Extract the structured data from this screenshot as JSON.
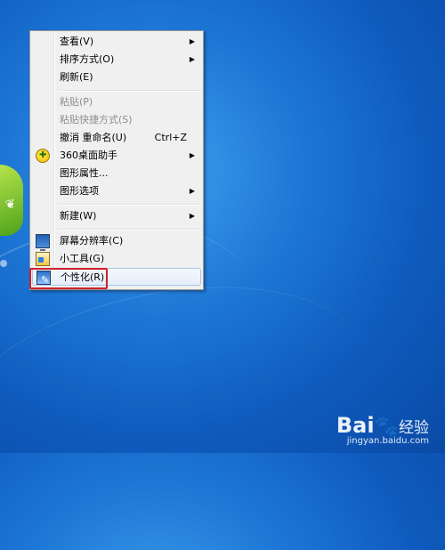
{
  "desktop": {
    "background_color": "#1a6fd0"
  },
  "context_menu": {
    "items": [
      {
        "label": "查看(V)",
        "submenu": true
      },
      {
        "label": "排序方式(O)",
        "submenu": true
      },
      {
        "label": "刷新(E)"
      },
      {
        "label": "粘贴(P)",
        "disabled": true
      },
      {
        "label": "粘贴快捷方式(S)",
        "disabled": true
      },
      {
        "label": "撤消 重命名(U)",
        "shortcut": "Ctrl+Z"
      },
      {
        "label": "360桌面助手",
        "submenu": true,
        "icon": "360-icon"
      },
      {
        "label": "图形属性..."
      },
      {
        "label": "图形选项",
        "submenu": true
      },
      {
        "label": "新建(W)",
        "submenu": true
      },
      {
        "label": "屏幕分辨率(C)",
        "icon": "monitor-icon"
      },
      {
        "label": "小工具(G)",
        "icon": "gadget-icon"
      },
      {
        "label": "个性化(R)",
        "icon": "personalize-icon",
        "highlighted": true
      }
    ],
    "arrow_glyph": "▶",
    "highlight_color": "#d0202b"
  },
  "watermark": {
    "brand": "Bai",
    "brand_paw": "🐾",
    "brand_jy": "经验",
    "url": "jingyan.baidu.com"
  }
}
